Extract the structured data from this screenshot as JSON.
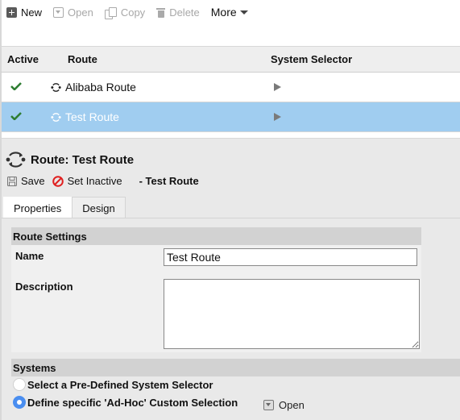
{
  "toolbar": {
    "new_label": "New",
    "open_label": "Open",
    "copy_label": "Copy",
    "delete_label": "Delete",
    "more_label": "More"
  },
  "grid": {
    "columns": [
      "Active",
      "Route",
      "System Selector"
    ],
    "rows": [
      {
        "active": true,
        "route": "Alibaba Route",
        "selected": false
      },
      {
        "active": true,
        "route": "Test Route",
        "selected": true
      }
    ]
  },
  "detail": {
    "title": "Route: Test Route",
    "actions": {
      "save_label": "Save",
      "set_inactive_label": "Set Inactive",
      "subtitle": "- Test Route"
    },
    "tabs": [
      {
        "label": "Properties",
        "active": true
      },
      {
        "label": "Design",
        "active": false
      }
    ],
    "route_settings": {
      "heading": "Route Settings",
      "name_label": "Name",
      "name_value": "Test Route",
      "description_label": "Description",
      "description_value": ""
    },
    "systems": {
      "heading": "Systems",
      "option_predefined": "Select a Pre-Defined System Selector",
      "option_adhoc": "Define specific 'Ad-Hoc' Custom Selection",
      "selected_option": "adhoc",
      "open_label": "Open"
    }
  },
  "colors": {
    "selected_row": "#a0cdf0",
    "check_green": "#2e7d32",
    "radio_blue": "#4a8ef0",
    "inactive_red": "#e02020"
  }
}
